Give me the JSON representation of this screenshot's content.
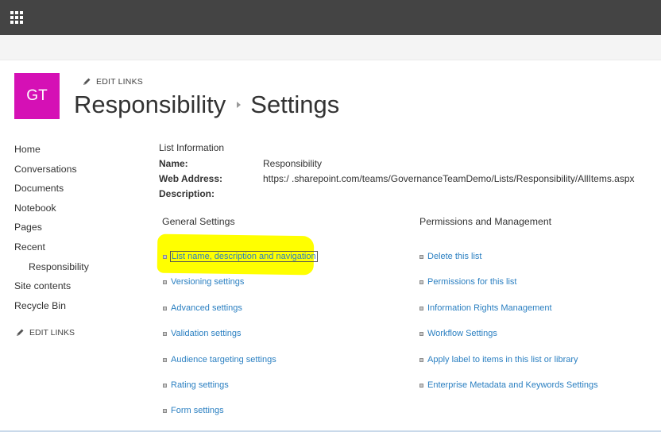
{
  "topbar": {
    "app_launcher_icon": "waffle-grid-icon"
  },
  "site": {
    "logo_text": "GT",
    "logo_color": "#d510b5",
    "edit_links_top": "EDIT LINKS",
    "title": "Responsibility",
    "subtitle": "Settings"
  },
  "leftnav": {
    "items": [
      {
        "label": "Home"
      },
      {
        "label": "Conversations"
      },
      {
        "label": "Documents"
      },
      {
        "label": "Notebook"
      },
      {
        "label": "Pages"
      },
      {
        "label": "Recent"
      },
      {
        "label": "Responsibility"
      },
      {
        "label": "Site contents"
      },
      {
        "label": "Recycle Bin"
      }
    ],
    "edit_links": "EDIT LINKS"
  },
  "list_info": {
    "heading": "List Information",
    "name_label": "Name:",
    "name_value": "Responsibility",
    "web_address_label": "Web Address:",
    "web_address_value": "https:/            .sharepoint.com/teams/GovernanceTeamDemo/Lists/Responsibility/AllItems.aspx",
    "description_label": "Description:",
    "description_value": ""
  },
  "general_settings": {
    "title": "General Settings",
    "links": [
      {
        "label": "List name, description and navigation"
      },
      {
        "label": "Versioning settings"
      },
      {
        "label": "Advanced settings"
      },
      {
        "label": "Validation settings"
      },
      {
        "label": "Audience targeting settings"
      },
      {
        "label": "Rating settings"
      },
      {
        "label": "Form settings"
      }
    ]
  },
  "permissions": {
    "title": "Permissions and Management",
    "links": [
      {
        "label": "Delete this list"
      },
      {
        "label": "Permissions for this list"
      },
      {
        "label": "Information Rights Management"
      },
      {
        "label": "Workflow Settings"
      },
      {
        "label": "Apply label to items in this list or library"
      },
      {
        "label": "Enterprise Metadata and Keywords Settings"
      }
    ]
  },
  "colors": {
    "topbar": "#444444",
    "link": "#2a7fc1",
    "highlight": "#ffff00"
  }
}
